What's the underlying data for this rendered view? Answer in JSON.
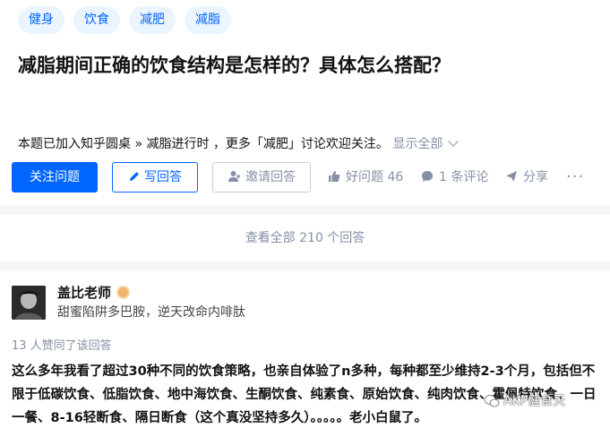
{
  "question": {
    "topics": [
      "健身",
      "饮食",
      "减肥",
      "减脂"
    ],
    "title": "减脂期间正确的饮食结构是怎样的？具体怎么搭配？",
    "description": "本题已加入知乎圆桌 » 减脂进行时 ，更多「减肥」讨论欢迎关注。",
    "show_all": "显示全部"
  },
  "actions": {
    "follow_label": "关注问题",
    "write_label": "写回答",
    "invite_label": "邀请回答",
    "good_question_label": "好问题 46",
    "comment_label": "1 条评论",
    "share_label": "分享",
    "more_label": "···"
  },
  "view_all": "查看全部 210 个回答",
  "answer": {
    "author_name": "盖比老师",
    "author_bio": "甜蜜陷阱多巴胺，逆天改命内啡肽",
    "votes_text": "13 人赞同了该回答",
    "content": "这么多年我看了超过30种不同的饮食策略，也亲自体验了n多种，每种都至少维持2-3个月，包括但不限于低碳饮食、低脂饮食、地中海饮食、生酮饮食、纯素食、原始饮食、纯肉饮食、霍佩特饮食、一日一餐、8-16轻断食、隔日断食（这个真没坚持多久）。。。。。老小白鼠了。"
  },
  "watermark": "AKP健食天",
  "colors": {
    "accent": "#0066ff",
    "muted": "#8590a6",
    "topic_bg": "#ebf5ff"
  },
  "icons": [
    "pencil-icon",
    "invite-user-icon",
    "thumbs-up-icon",
    "comment-bubble-icon",
    "share-plane-icon",
    "chevron-down-icon",
    "verified-badge-icon",
    "wechat-icon"
  ]
}
